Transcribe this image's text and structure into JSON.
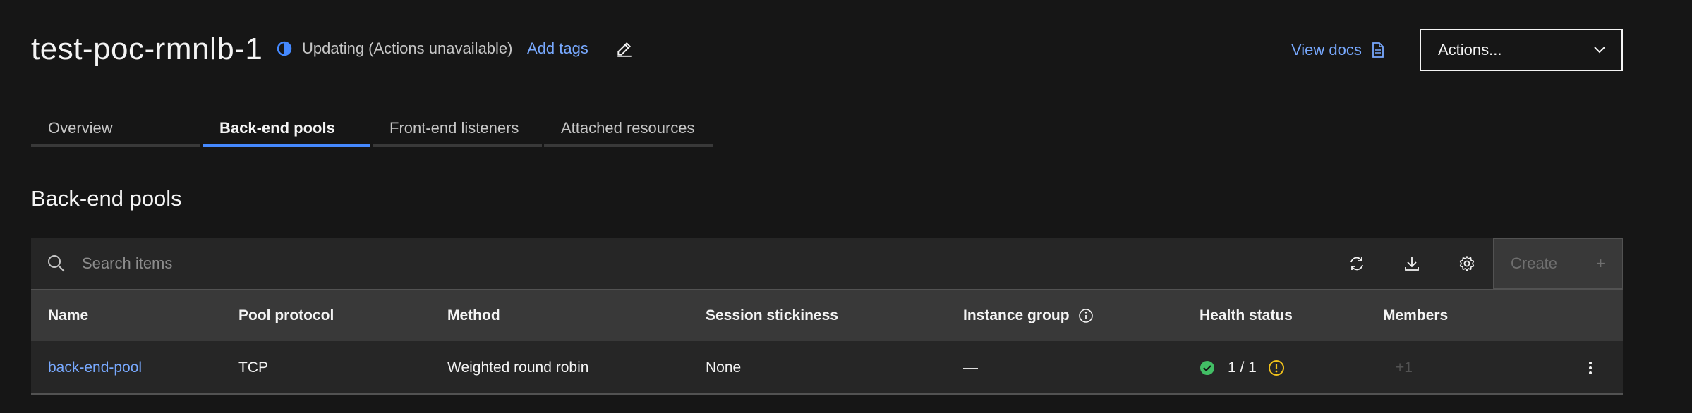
{
  "header": {
    "title": "test-poc-rmnlb-1",
    "status_text": "Updating (Actions unavailable)",
    "add_tags": "Add tags",
    "view_docs": "View docs",
    "actions_label": "Actions..."
  },
  "tabs": [
    {
      "label": "Overview",
      "active": false
    },
    {
      "label": "Back-end pools",
      "active": true
    },
    {
      "label": "Front-end listeners",
      "active": false
    },
    {
      "label": "Attached resources",
      "active": false
    }
  ],
  "section_title": "Back-end pools",
  "toolbar": {
    "search_placeholder": "Search items",
    "create_label": "Create",
    "create_icon": "+"
  },
  "table": {
    "columns": [
      "Name",
      "Pool protocol",
      "Method",
      "Session stickiness",
      "Instance group",
      "Health status",
      "Members"
    ],
    "rows": [
      {
        "name": "back-end-pool",
        "protocol": "TCP",
        "method": "Weighted round robin",
        "stickiness": "None",
        "instance_group": "—",
        "health": "1 / 1",
        "members": "+1"
      }
    ]
  },
  "colors": {
    "background": "#161616",
    "link": "#78a9ff",
    "tab_active": "#4589ff",
    "success": "#42be65",
    "warning": "#f1c21b"
  }
}
